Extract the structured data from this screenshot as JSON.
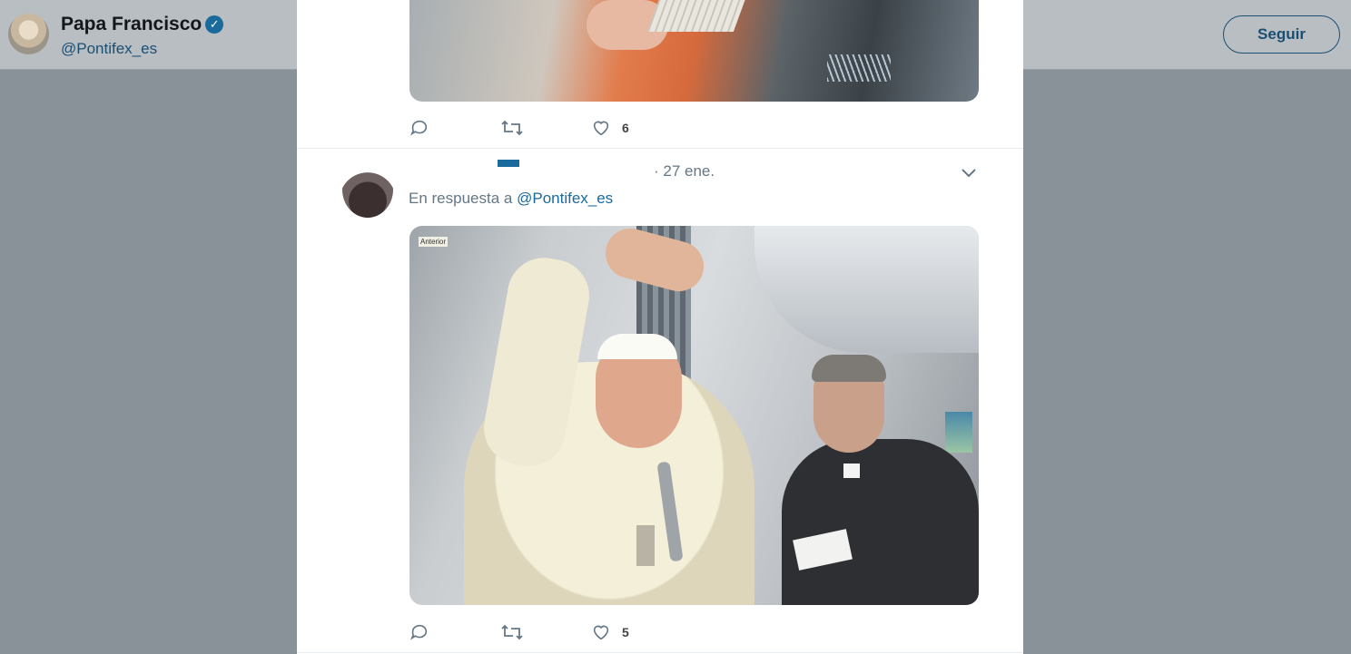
{
  "profile": {
    "name": "Papa Francisco",
    "handle": "@Pontifex_es",
    "follow_label": "Seguir",
    "verified_icon": "verified-badge-icon"
  },
  "tweet_prev": {
    "like_count": "6"
  },
  "tweet_current": {
    "timestamp": "· 27 ene.",
    "reply_prefix": "En respuesta a",
    "reply_mention": "@Pontifex_es",
    "image_badge": "Anterior",
    "like_count": "5"
  },
  "colors": {
    "accent": "#1b6a9c",
    "muted_text": "#657786",
    "overlay": "#8a9299"
  }
}
